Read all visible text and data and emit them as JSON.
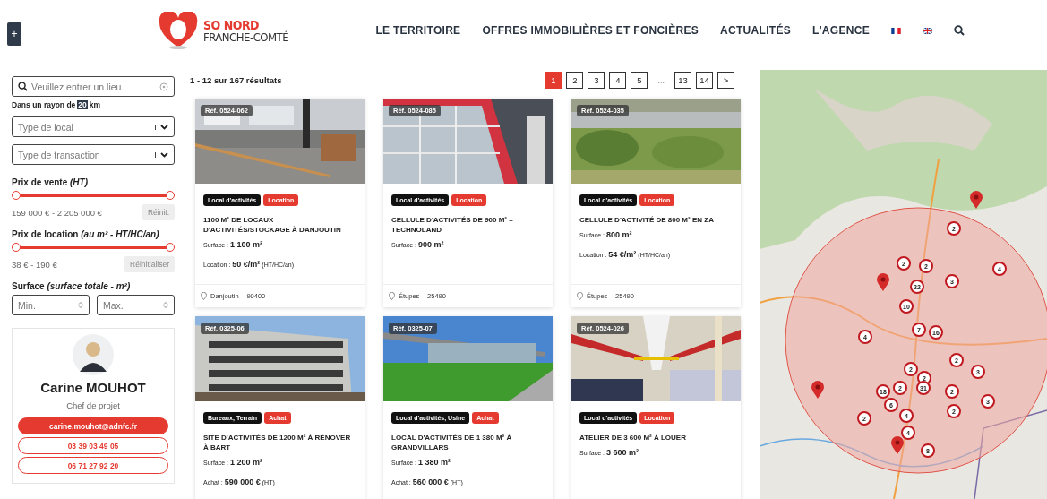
{
  "header": {
    "logo": {
      "line1": "SO NORD",
      "line2": "FRANCHE-COMTÉ"
    },
    "side_toggle": "+",
    "nav": [
      {
        "label": "LE TERRITOIRE",
        "kind": "link"
      },
      {
        "label": "OFFRES IMMOBILIÈRES ET FONCIÈRES",
        "kind": "link"
      },
      {
        "label": "ACTUALITÉS",
        "kind": "link"
      },
      {
        "label": "L'AGENCE",
        "kind": "link"
      },
      {
        "kind": "flag-fr"
      },
      {
        "kind": "flag-uk"
      },
      {
        "kind": "search"
      }
    ]
  },
  "filters": {
    "location": {
      "placeholder": "Veuillez entrer un lieu"
    },
    "radius": {
      "prefix": "Dans un rayon de",
      "value": "20",
      "suffix": "km"
    },
    "selects": [
      {
        "placeholder": "Type de local"
      },
      {
        "placeholder": "Type de transaction"
      }
    ],
    "ranges": [
      {
        "label": "Prix de vente *(HT)*",
        "level": 1,
        "reading": "159 000 € - 2 205 000 €",
        "reset": "Réinit."
      },
      {
        "label": "Prix de location *(au m² - HT/HC/an)*",
        "level": 1,
        "reading": "38 € - 190 €",
        "reset": "Réinitialiser"
      }
    ],
    "surface": {
      "label": "Surface *(surface totale - m²)*",
      "min_placeholder": "Min.",
      "max_placeholder": "Max."
    }
  },
  "contact": {
    "name": "Carine MOUHOT",
    "role": "Chef de projet",
    "email": "carine.mouhot@adnfc.fr",
    "phones": [
      "03 39 03 49 05",
      "06 71 27 92 20"
    ]
  },
  "results": {
    "count": "1 - 12 sur 167 résultats",
    "pagination": [
      {
        "label": "1",
        "kind": "page",
        "selected": true
      },
      {
        "label": "2",
        "kind": "page",
        "selected": false
      },
      {
        "label": "3",
        "kind": "page",
        "selected": false
      },
      {
        "label": "4",
        "kind": "page",
        "selected": false
      },
      {
        "label": "5",
        "kind": "page",
        "selected": false
      },
      {
        "label": "...",
        "kind": "gap"
      },
      {
        "label": "13",
        "kind": "page",
        "selected": false
      },
      {
        "label": "14",
        "kind": "page",
        "selected": false
      },
      {
        "label": ">",
        "kind": "page",
        "selected": false
      }
    ],
    "cards": [
      {
        "ref": "Réf. 0524-062",
        "tags": [
          {
            "label": "Local d'activités",
            "kind": "type"
          },
          {
            "label": "Location",
            "kind": "transaction"
          }
        ],
        "title": "1100 M² DE LOCAUX D'ACTIVITÉS/STOCKAGE À DANJOUTIN",
        "specs": [
          {
            "label": "Surface :",
            "value": "1 100 m²"
          },
          {
            "label": "Location :",
            "value": "50 €/m²",
            "unit": "(HT/HC/an)"
          }
        ],
        "location": "Danjoutin  - 90400"
      },
      {
        "ref": "Réf. 0524-085",
        "tags": [
          {
            "label": "Local d'activités",
            "kind": "type"
          },
          {
            "label": "Location",
            "kind": "transaction"
          }
        ],
        "title": "CELLULE D'ACTIVITÉS DE 900 M² – TECHNOLAND",
        "specs": [
          {
            "label": "Surface :",
            "value": "900 m²"
          }
        ],
        "location": "Étupes  - 25490"
      },
      {
        "ref": "Réf. 0524-035",
        "tags": [
          {
            "label": "Local d'activités",
            "kind": "type"
          },
          {
            "label": "Location",
            "kind": "transaction"
          }
        ],
        "title": "CELLULE D'ACTIVITÉ DE 800 M² EN ZA",
        "specs": [
          {
            "label": "Surface :",
            "value": "800 m²"
          },
          {
            "label": "Location :",
            "value": "54 €/m²",
            "unit": "(HT/HC/an)"
          }
        ],
        "location": "Étupes  - 25490"
      },
      {
        "ref": "Réf. 0325-06",
        "tags": [
          {
            "label": "Bureaux, Terrain",
            "kind": "type"
          },
          {
            "label": "Achat",
            "kind": "transaction"
          }
        ],
        "title": "SITE D'ACTIVITÉS DE 1200 M² À RÉNOVER À BART",
        "specs": [
          {
            "label": "Surface :",
            "value": "1 200 m²"
          },
          {
            "label": "Achat :",
            "value": "590 000 €",
            "unit": "(HT)"
          }
        ]
      },
      {
        "ref": "Réf. 0325-07",
        "tags": [
          {
            "label": "Local d'activités, Usine",
            "kind": "type"
          },
          {
            "label": "Achat",
            "kind": "transaction"
          }
        ],
        "title": "LOCAL D'ACTIVITÉS DE 1 380 M² À GRANDVILLARS",
        "specs": [
          {
            "label": "Surface :",
            "value": "1 380 m²"
          },
          {
            "label": "Achat :",
            "value": "560 000 €",
            "unit": "(HT)"
          }
        ]
      },
      {
        "ref": "Réf. 0524-026",
        "tags": [
          {
            "label": "Local d'activités",
            "kind": "type"
          },
          {
            "label": "Location",
            "kind": "transaction"
          }
        ],
        "title": "ATELIER DE 3 600 M² À LOUER",
        "specs": [
          {
            "label": "Surface :",
            "value": "3 600 m²"
          }
        ]
      }
    ]
  },
  "map": {
    "clusters": [
      {
        "count": "2"
      },
      {
        "count": "2"
      },
      {
        "count": "2"
      },
      {
        "count": "4"
      },
      {
        "count": "3"
      },
      {
        "count": "22"
      },
      {
        "count": "10"
      },
      {
        "count": "7"
      },
      {
        "count": "16"
      },
      {
        "count": "4"
      },
      {
        "count": "2"
      },
      {
        "count": "3"
      },
      {
        "count": "2"
      },
      {
        "count": "2"
      },
      {
        "count": "2"
      },
      {
        "count": "31"
      },
      {
        "count": "2"
      },
      {
        "count": "18"
      },
      {
        "count": "3"
      },
      {
        "count": "6"
      },
      {
        "count": "2"
      },
      {
        "count": "2"
      },
      {
        "count": "4"
      },
      {
        "count": "4"
      },
      {
        "count": "8"
      }
    ]
  }
}
